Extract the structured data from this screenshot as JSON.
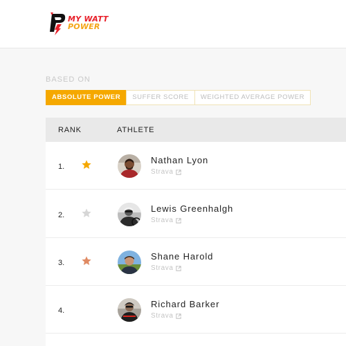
{
  "brand": {
    "line1": "MY WATT",
    "line2": "POWER",
    "colors": {
      "red": "#e8202a",
      "orange": "#f4a415",
      "black": "#111111"
    }
  },
  "filter": {
    "label": "BASED ON",
    "tabs": [
      {
        "label": "ABSOLUTE POWER",
        "active": true
      },
      {
        "label": "SUFFER SCORE",
        "active": false
      },
      {
        "label": "WEIGHTED AVERAGE POWER",
        "active": false
      }
    ]
  },
  "table": {
    "headers": {
      "rank": "RANK",
      "athlete": "ATHLETE"
    },
    "rows": [
      {
        "rank": "1.",
        "name": "Nathan Lyon",
        "source": "Strava",
        "medal": "gold",
        "star_color": "#f5a800",
        "avatar_icon": "athlete-photo-icon"
      },
      {
        "rank": "2.",
        "name": "Lewis Greenhalgh",
        "source": "Strava",
        "medal": "silver",
        "star_color": "#d6d6d6",
        "avatar_icon": "athlete-photo-icon"
      },
      {
        "rank": "3.",
        "name": "Shane Harold",
        "source": "Strava",
        "medal": "bronze",
        "star_color": "#e08a63",
        "avatar_icon": "athlete-photo-icon"
      },
      {
        "rank": "4.",
        "name": "Richard Barker",
        "source": "Strava",
        "medal": "",
        "star_color": "",
        "avatar_icon": "athlete-photo-icon"
      }
    ]
  },
  "colors": {
    "accent": "#f5a800",
    "header_bg": "#e9e9e9",
    "muted_text": "#c4c4c4"
  }
}
